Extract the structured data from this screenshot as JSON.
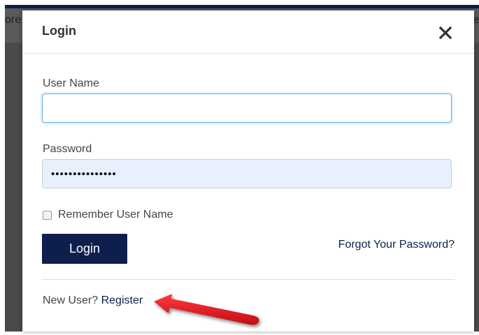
{
  "background": {
    "left_text": "ore",
    "right_text": "e"
  },
  "modal": {
    "title": "Login",
    "close_icon": "close-icon",
    "username": {
      "label": "User Name",
      "value": "",
      "placeholder": ""
    },
    "password": {
      "label": "Password",
      "value": "•••••••••••••••"
    },
    "remember": {
      "label": "Remember User Name",
      "checked": false
    },
    "login_button_label": "Login",
    "forgot_link": "Forgot Your Password?",
    "new_user_text": "New User?",
    "register_link": "Register"
  },
  "annotation": {
    "type": "red-arrow-pointing-left",
    "color": "#e8141a"
  },
  "colors": {
    "brand_navy": "#0e1f4d",
    "focus_border": "#66afe9",
    "autofill_bg": "#e8f0fe"
  }
}
